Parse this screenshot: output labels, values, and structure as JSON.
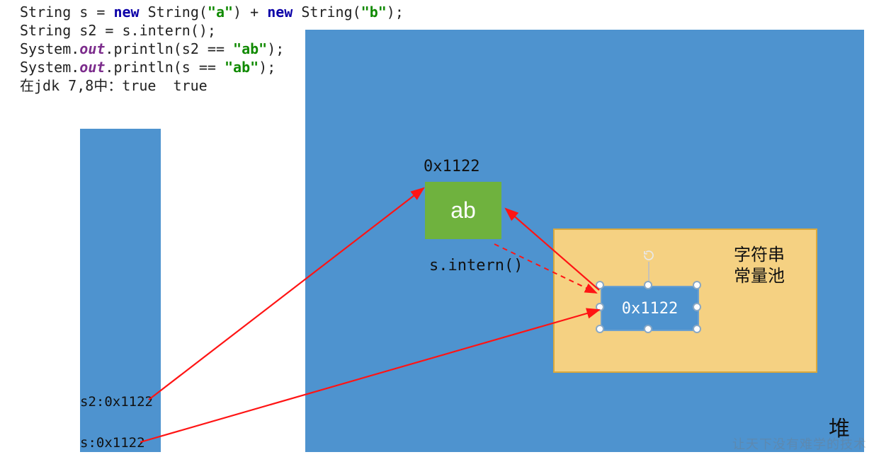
{
  "code": {
    "line1_type": "String",
    "line1_var": " s = ",
    "line1_new1": "new",
    "line1_mid1": " String(",
    "line1_str1": "\"a\"",
    "line1_mid2": ") + ",
    "line1_new2": "new",
    "line1_mid3": " String(",
    "line1_str2": "\"b\"",
    "line1_end": ");",
    "line2_type": "String",
    "line2_rest": " s2 = s.intern();",
    "line3_sys": "System.",
    "line3_out": "out",
    "line3_mid": ".println(s2 == ",
    "line3_str": "\"ab\"",
    "line3_end": ");",
    "line4_sys": "System.",
    "line4_out": "out",
    "line4_mid": ".println(s == ",
    "line4_str": "\"ab\"",
    "line4_end": ");",
    "line5": "在jdk 7,8中：true  true"
  },
  "stack": {
    "s2_label": "s2:0x1122",
    "s_label": "s:0x1122"
  },
  "heap": {
    "label": "堆",
    "addr": "0x1122",
    "ab_value": "ab",
    "intern_call": "s.intern()"
  },
  "pool": {
    "label_line1": "字符串",
    "label_line2": "常量池",
    "ref_value": "0x1122"
  },
  "watermark": "让天下没有难学的技术"
}
